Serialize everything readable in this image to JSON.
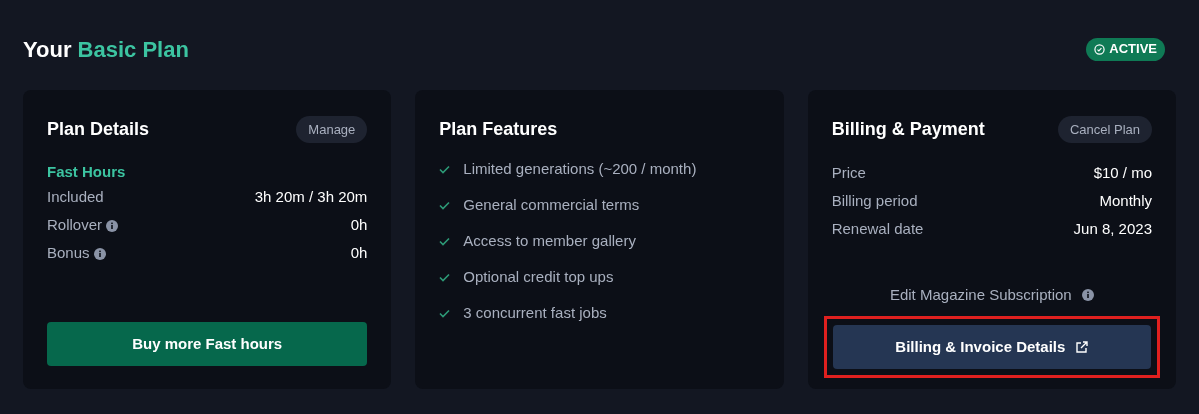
{
  "heading": {
    "prefix": "Your",
    "plan": "Basic Plan"
  },
  "status_badge": {
    "label": "ACTIVE",
    "active": true
  },
  "plan_details": {
    "title": "Plan Details",
    "action": "Manage",
    "section": "Fast Hours",
    "rows": [
      {
        "label": "Included",
        "value": "3h 20m / 3h 20m",
        "info": false
      },
      {
        "label": "Rollover",
        "value": "0h",
        "info": true
      },
      {
        "label": "Bonus",
        "value": "0h",
        "info": true
      }
    ],
    "button": "Buy more Fast hours"
  },
  "plan_features": {
    "title": "Plan Features",
    "items": [
      "Limited generations (~200 / month)",
      "General commercial terms",
      "Access to member gallery",
      "Optional credit top ups",
      "3 concurrent fast jobs"
    ]
  },
  "billing": {
    "title": "Billing & Payment",
    "action": "Cancel Plan",
    "rows": [
      {
        "label": "Price",
        "value": "$10 / mo"
      },
      {
        "label": "Billing period",
        "value": "Monthly"
      },
      {
        "label": "Renewal date",
        "value": "Jun 8, 2023"
      }
    ],
    "link": "Edit Magazine Subscription",
    "button": {
      "label": "Billing & Invoice Details",
      "highlighted": true
    }
  }
}
